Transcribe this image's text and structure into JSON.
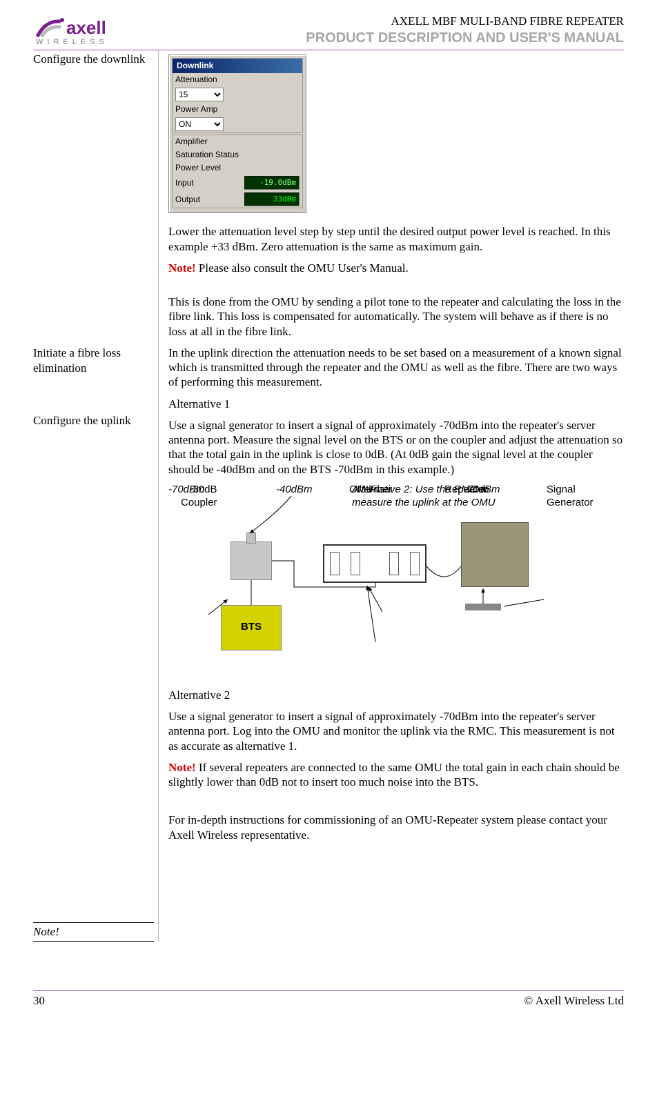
{
  "header": {
    "logo_main": "axell",
    "logo_sub": "WIRELESS",
    "doc_title_small": "AXELL MBF MULI-BAND FIBRE REPEATER",
    "doc_title_large": "PRODUCT DESCRIPTION AND USER'S MANUAL"
  },
  "sidebar": {
    "s1": "Configure the downlink",
    "s2": "Initiate a fibre loss elimination",
    "s3": "Configure the uplink",
    "note": "Note!"
  },
  "panel": {
    "title": "Downlink",
    "atten_label": "Attenuation",
    "atten_value": "15",
    "poweramp_label": "Power Amp",
    "poweramp_value": "ON",
    "amplifier": "Amplifier",
    "saturation": "Saturation Status",
    "powerlevel": "Power Level",
    "input_label": "Input",
    "input_value": "-19.0dBm",
    "output_label": "Output",
    "output_value": "33dBm"
  },
  "main": {
    "p1": "Lower the attenuation level step by step until the desired output power level is reached. In this example +33 dBm. Zero attenuation is the same as maximum gain.",
    "note1_prefix": "Note!",
    "note1_text": " Please also consult the OMU User's Manual.",
    "p2": "This is done from the OMU by sending a pilot tone to the repeater and calculating the loss in the fibre link. This loss is compensated for automatically. The system will behave as if there is no loss at all in the fibre link.",
    "p3": "In the uplink direction the attenuation needs to be set based on a measurement of a known signal which is transmitted through the repeater and the OMU as well as the fibre. There are two ways of performing this measurement.",
    "alt1_title": "Alternative 1",
    "alt1_text": "Use a signal generator to insert a signal of approximately -70dBm into the repeater's server antenna port. Measure the signal level on the BTS or on the coupler and adjust the attenuation so that the total gain in the uplink is close to 0dB. (At 0dB gain the signal level at the coupler should be -40dBm and on the BTS -70dBm in this example.)",
    "alt2_title": "Alternative 2",
    "alt2_text": "Use a signal generator to insert a signal of approximately -70dBm into the repeater's server antenna port. Log into the OMU and monitor the uplink via the RMC. This measurement is not as accurate as alternative 1.",
    "note2_prefix": "Note!",
    "note2_text": " If several repeaters are connected to the same OMU the total gain in each chain should be slightly lower than 0dB not to insert too much noise into the BTS.",
    "p_final": "For in-depth instructions for commissioning of an OMU-Repeater system please contact your Axell Wireless representative."
  },
  "diagram": {
    "d40": "-40dBm",
    "repeater": "Repeater",
    "omu": "OMU",
    "coupler": "-30dB\nCoupler",
    "n70a": "-70dBm",
    "bts": "BTS",
    "fiber": "Fiber",
    "n70b": "-70dBm",
    "siggen": "Signal\nGenerator",
    "alt2": "Alternative 2: Use the RMC to measure the uplink at the OMU"
  },
  "footer": {
    "page": "30",
    "copyright": "© Axell Wireless Ltd"
  }
}
